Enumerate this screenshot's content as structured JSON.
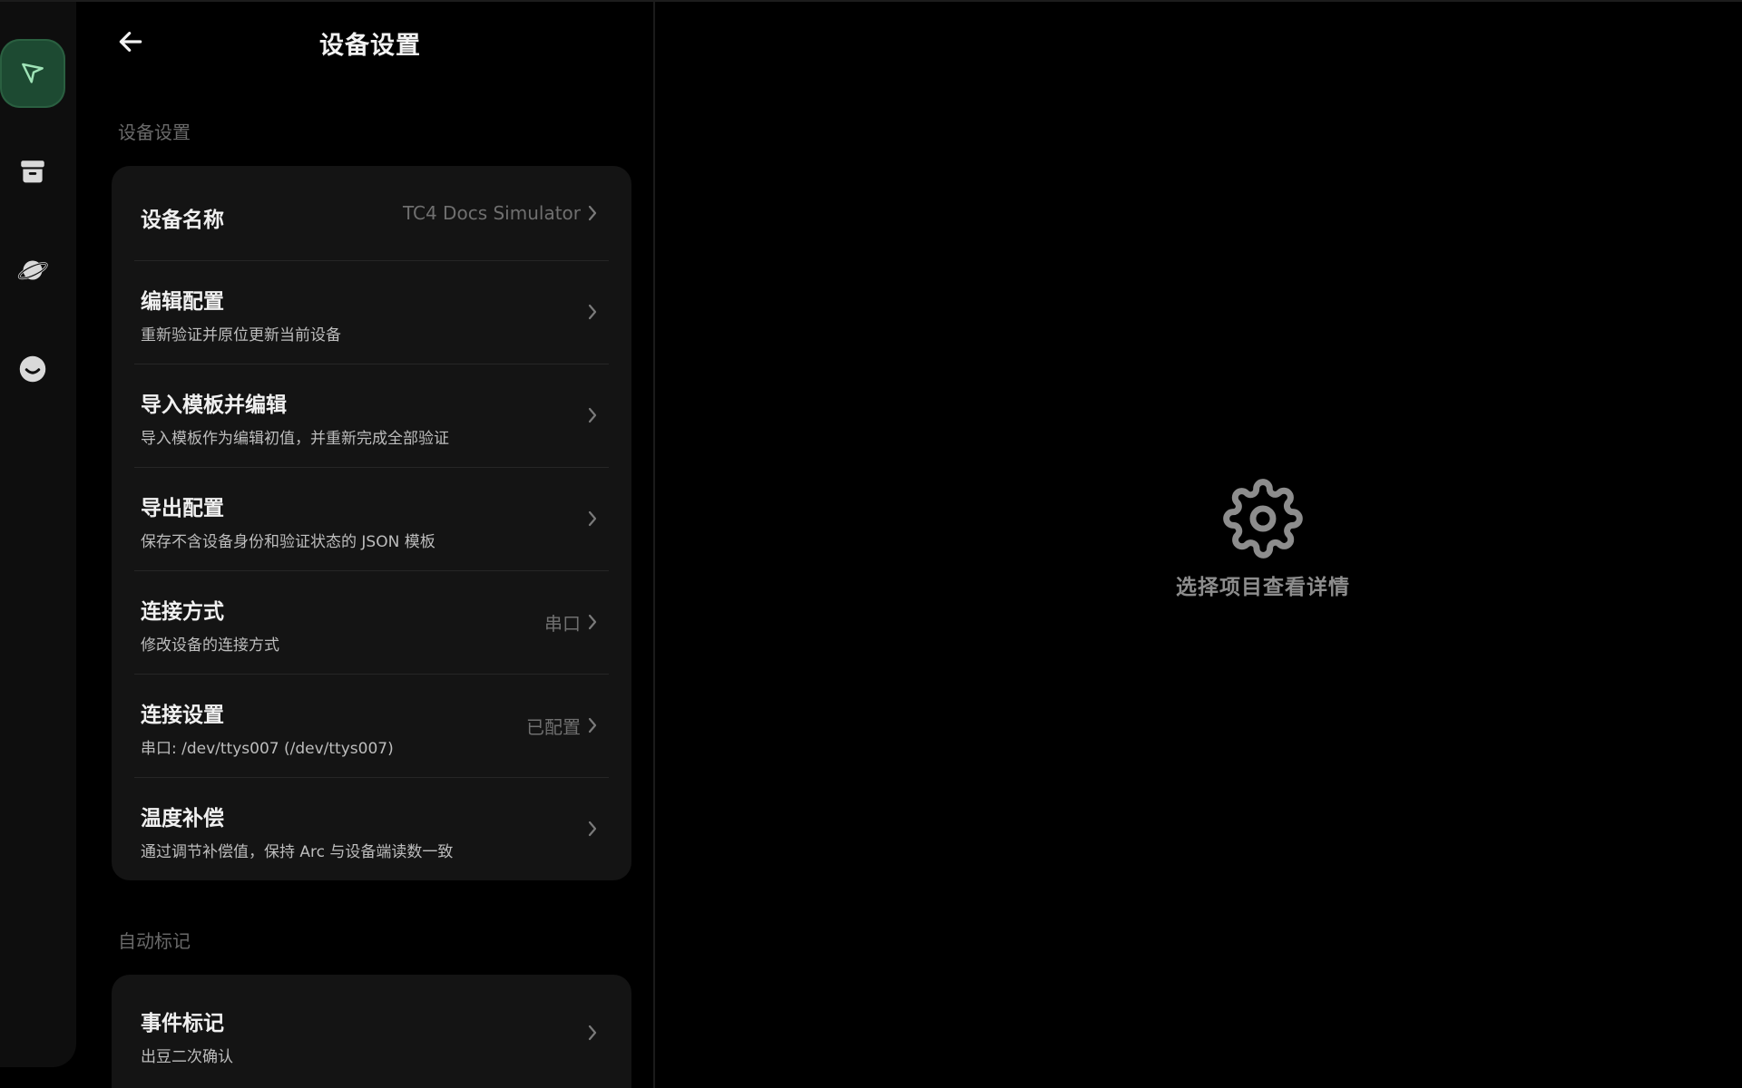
{
  "colors": {
    "background": "#000000",
    "rail": "#0e0e0e",
    "card": "#141414",
    "accent_active": "#1d4a32",
    "accent_icon": "#7fd6a0",
    "muted_text": "#6f6f6f"
  },
  "rail": {
    "items": [
      {
        "icon": "navigation-arrow-icon",
        "active": true
      },
      {
        "icon": "archive-box-icon",
        "active": false
      },
      {
        "icon": "planet-icon",
        "active": false
      },
      {
        "icon": "smiley-face-icon",
        "active": false
      }
    ]
  },
  "header": {
    "back_icon": "arrow-left-icon",
    "title": "设备设置"
  },
  "sections": [
    {
      "label": "设备设置",
      "rows": [
        {
          "title": "设备名称",
          "subtitle": "",
          "value": "TC4 Docs Simulator"
        },
        {
          "title": "编辑配置",
          "subtitle": "重新验证并原位更新当前设备",
          "value": ""
        },
        {
          "title": "导入模板并编辑",
          "subtitle": "导入模板作为编辑初值，并重新完成全部验证",
          "value": ""
        },
        {
          "title": "导出配置",
          "subtitle": "保存不含设备身份和验证状态的 JSON 模板",
          "value": ""
        },
        {
          "title": "连接方式",
          "subtitle": "修改设备的连接方式",
          "value": "串口"
        },
        {
          "title": "连接设置",
          "subtitle": "串口: /dev/ttys007 (/dev/ttys007)",
          "value": "已配置"
        },
        {
          "title": "温度补偿",
          "subtitle": "通过调节补偿值，保持 Arc 与设备端读数一致",
          "value": ""
        }
      ]
    },
    {
      "label": "自动标记",
      "rows": [
        {
          "title": "事件标记",
          "subtitle": "出豆二次确认",
          "value": ""
        }
      ]
    }
  ],
  "detail": {
    "icon": "gear-icon",
    "empty_text": "选择项目查看详情"
  }
}
